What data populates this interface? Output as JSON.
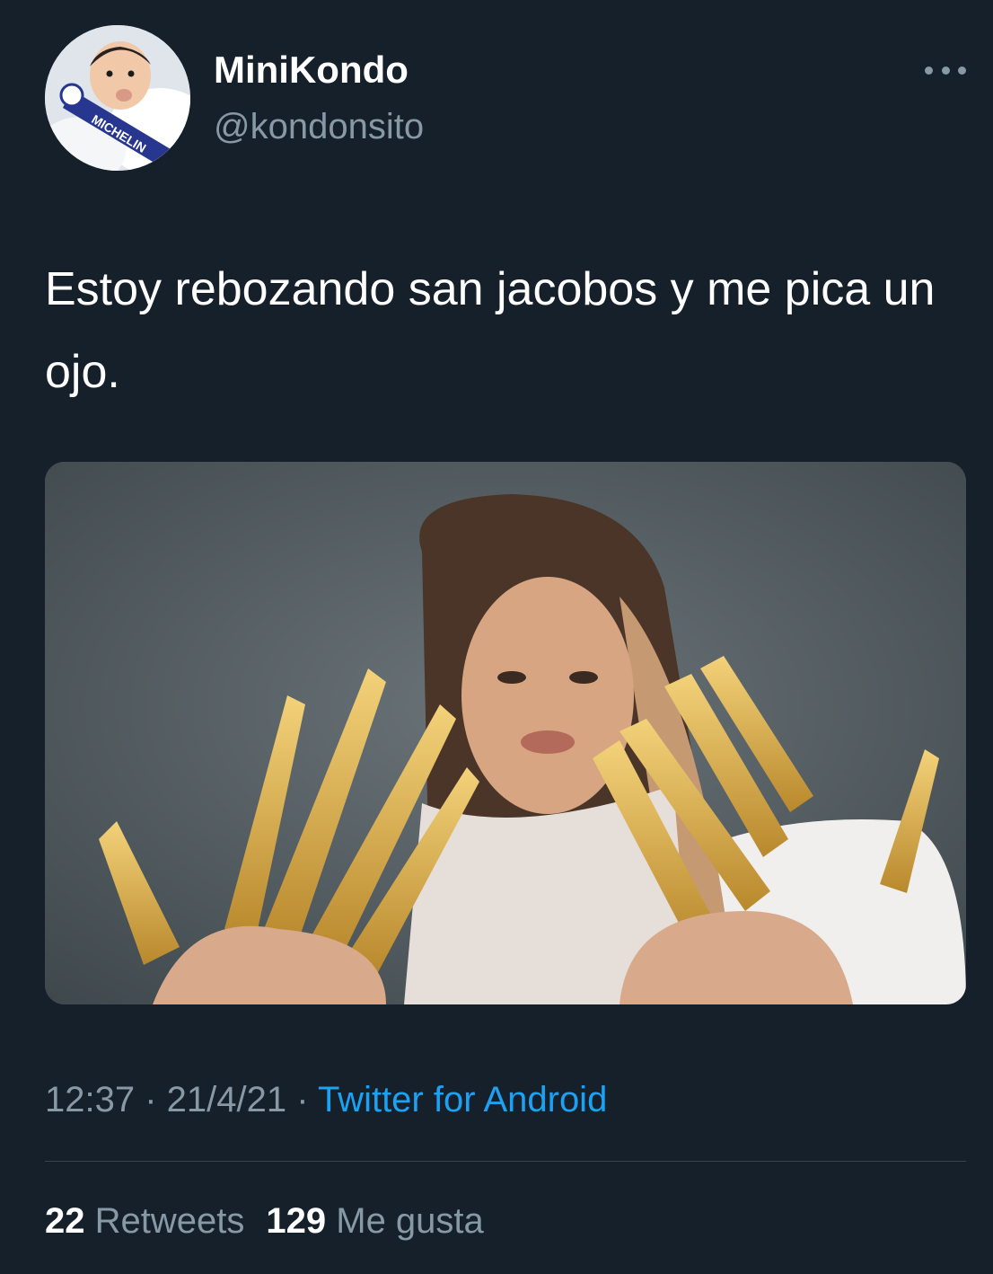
{
  "user": {
    "display_name": "MiniKondo",
    "handle": "@kondonsito",
    "avatar_badge_text": "MICHELIN"
  },
  "tweet": {
    "text": "Estoy rebozando san jacobos y me pica un ojo.",
    "time": "12:37",
    "separator": " · ",
    "date": "21/4/21",
    "source": "Twitter for Android"
  },
  "stats": {
    "retweets_count": "22",
    "retweets_label": "Retweets",
    "likes_count": "129",
    "likes_label": "Me gusta"
  },
  "icons": {
    "more": "more-horizontal-icon"
  },
  "colors": {
    "background": "#15202b",
    "primary_text": "#ffffff",
    "secondary_text": "#8899a6",
    "link": "#1da1f2",
    "divider": "#38444d"
  }
}
